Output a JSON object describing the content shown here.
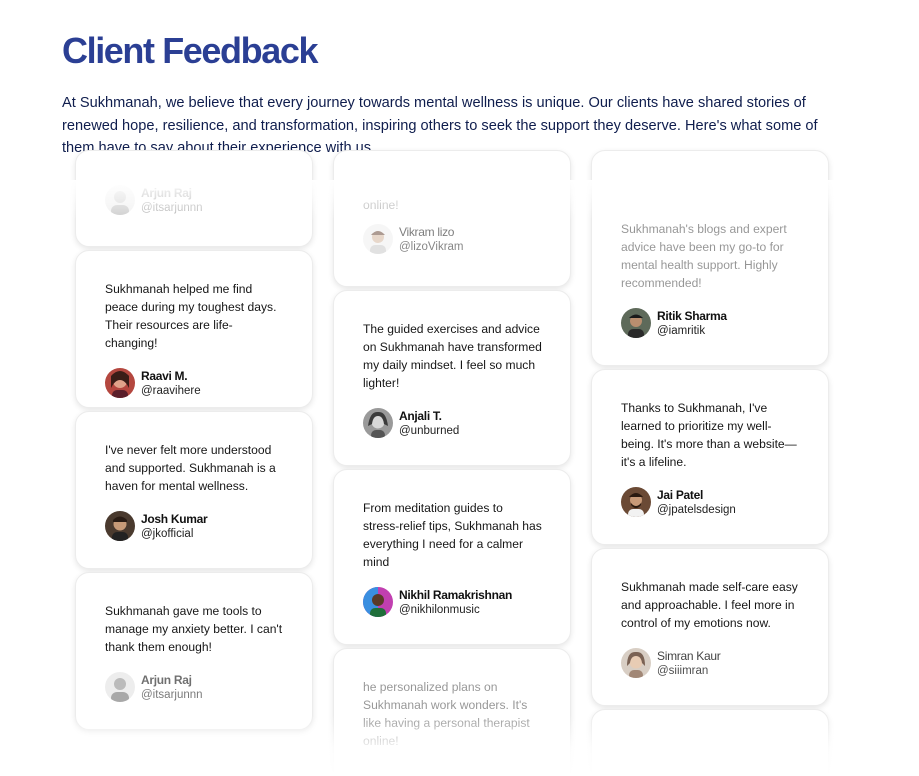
{
  "section": {
    "heading": "Client Feedback",
    "intro": "At Sukhmanah, we believe that every journey towards mental wellness is unique. Our clients have shared stories of renewed hope, resilience, and transformation, inspiring others to seek the support they deserve. Here's what some of them have to say about their experience with us."
  },
  "columns": [
    {
      "cards": [
        {
          "quote": "",
          "name": "Arjun Raj",
          "handle": "@itsarjunnn"
        },
        {
          "quote": "Sukhmanah helped me find peace during my toughest days. Their resources are life-changing!",
          "name": "Raavi M.",
          "handle": "@raavihere"
        },
        {
          "quote": "I've never felt more understood and supported. Sukhmanah is a haven for mental wellness.",
          "name": "Josh Kumar",
          "handle": "@jkofficial"
        },
        {
          "quote": "Sukhmanah gave me tools to manage my anxiety better. I can't thank them enough!",
          "name": "Arjun Raj",
          "handle": "@itsarjunnn"
        }
      ]
    },
    {
      "cards": [
        {
          "quote": "online!",
          "name": "Vikram lizo",
          "handle": "@lizoVikram"
        },
        {
          "quote": "The guided exercises and advice on Sukhmanah have transformed my daily mindset. I feel so much lighter!",
          "name": "Anjali T.",
          "handle": "@unburned"
        },
        {
          "quote": "From meditation guides to stress-relief tips, Sukhmanah has everything I need for a calmer mind",
          "name": "Nikhil Ramakrishnan",
          "handle": "@nikhilonmusic"
        },
        {
          "quote": "he personalized plans on Sukhmanah work wonders. It's like having a personal therapist online!",
          "name": "",
          "handle": ""
        }
      ]
    },
    {
      "cards": [
        {
          "quote": "Sukhmanah's blogs and expert advice have been my go-to for mental health support. Highly recommended!",
          "name": "Ritik Sharma",
          "handle": "@iamritik"
        },
        {
          "quote": "Thanks to Sukhmanah, I've learned to prioritize my well-being. It's more than a website—it's a lifeline.",
          "name": "Jai Patel",
          "handle": "@jpatelsdesign"
        },
        {
          "quote": "Sukhmanah made self-care easy and approachable. I feel more in control of my emotions now.",
          "name": "Simran Kaur",
          "handle": "@siiimran"
        },
        {
          "quote": "",
          "name": "",
          "handle": ""
        }
      ]
    }
  ]
}
